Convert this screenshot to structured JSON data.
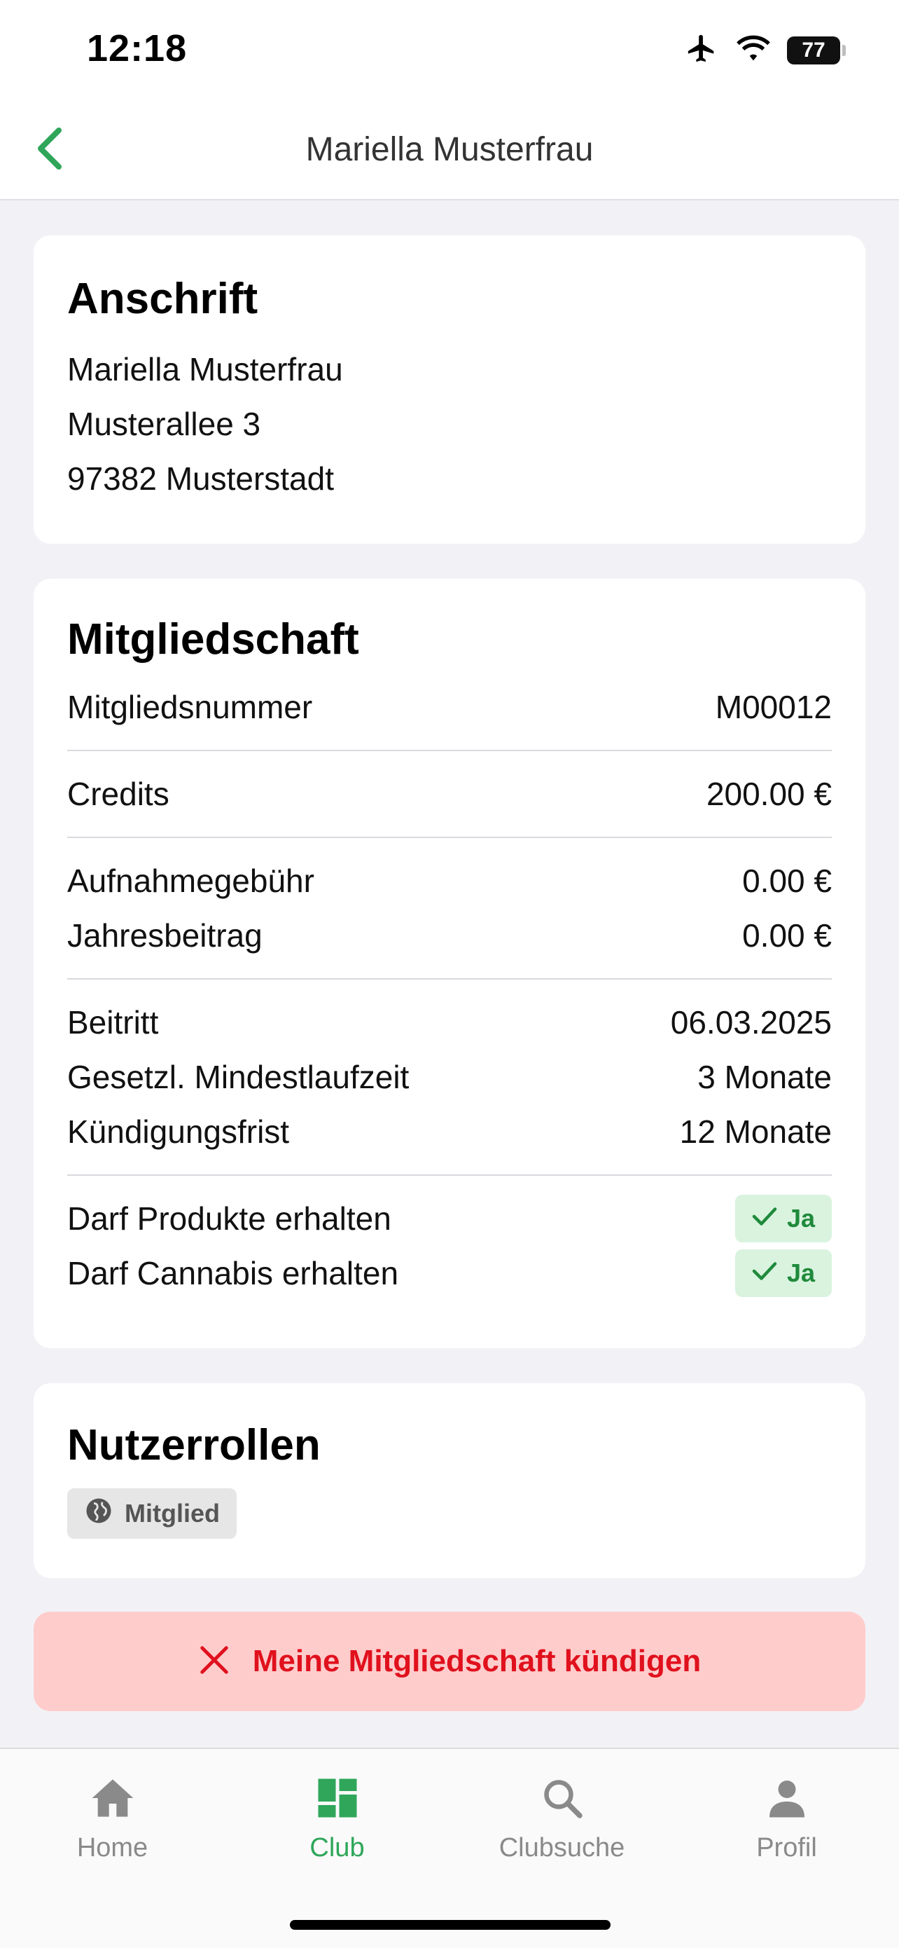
{
  "status": {
    "time": "12:18",
    "battery": "77"
  },
  "nav": {
    "title": "Mariella Musterfrau"
  },
  "address": {
    "title": "Anschrift",
    "lines": [
      "Mariella Musterfrau",
      "Musterallee 3",
      "97382 Musterstadt"
    ]
  },
  "membership": {
    "title": "Mitgliedschaft",
    "number_label": "Mitgliedsnummer",
    "number_value": "M00012",
    "credits_label": "Credits",
    "credits_value": "200.00 €",
    "fee_label": "Aufnahmegebühr",
    "fee_value": "0.00 €",
    "annual_label": "Jahresbeitrag",
    "annual_value": "0.00 €",
    "join_label": "Beitritt",
    "join_value": "06.03.2025",
    "minterm_label": "Gesetzl. Mindestlaufzeit",
    "minterm_value": "3 Monate",
    "notice_label": "Kündigungsfrist",
    "notice_value": "12 Monate",
    "products_label": "Darf Produkte erhalten",
    "products_value": "Ja",
    "cannabis_label": "Darf Cannabis erhalten",
    "cannabis_value": "Ja"
  },
  "roles": {
    "title": "Nutzerrollen",
    "chip": "Mitglied"
  },
  "actions": {
    "cancel_label": "Meine Mitgliedschaft kündigen"
  },
  "tabs": [
    {
      "label": "Home",
      "icon": "home-icon"
    },
    {
      "label": "Club",
      "icon": "dashboard-icon"
    },
    {
      "label": "Clubsuche",
      "icon": "search-icon"
    },
    {
      "label": "Profil",
      "icon": "person-icon"
    }
  ],
  "colors": {
    "accent": "#2fa65a",
    "danger": "#e0111d",
    "danger_bg": "#ffcccc"
  }
}
